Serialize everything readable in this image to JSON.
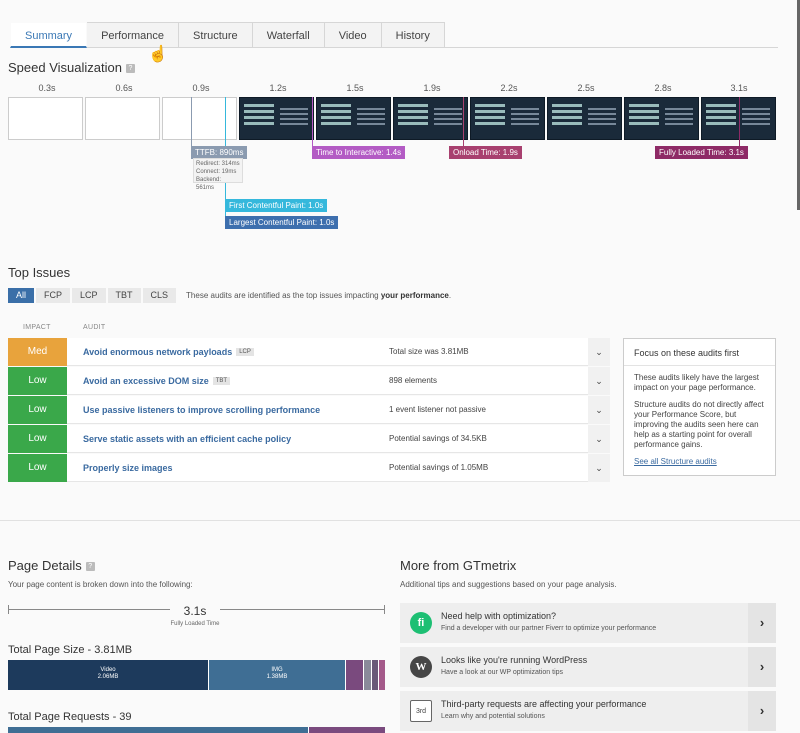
{
  "tabs": [
    {
      "label": "Summary"
    },
    {
      "label": "Performance"
    },
    {
      "label": "Structure"
    },
    {
      "label": "Waterfall"
    },
    {
      "label": "Video"
    },
    {
      "label": "History"
    }
  ],
  "speed_visualization": {
    "title": "Speed Visualization",
    "help": "?",
    "ticks": [
      "0.3s",
      "0.6s",
      "0.9s",
      "1.2s",
      "1.5s",
      "1.9s",
      "2.2s",
      "2.5s",
      "2.8s",
      "3.1s"
    ],
    "markers": {
      "ttfb": "TTFB: 890ms",
      "ttfb_detail": [
        "Redirect: 314ms",
        "Connect: 19ms",
        "Backend: 561ms"
      ],
      "tti": "Time to Interactive: 1.4s",
      "onload": "Onload Time: 1.9s",
      "fully_loaded": "Fully Loaded Time: 3.1s",
      "fcp": "First Contentful Paint: 1.0s",
      "lcp": "Largest Contentful Paint: 1.0s"
    },
    "colors": {
      "ttfb": "#8b9bb0",
      "tti": "#b35bc4",
      "onload": "#a8406f",
      "fully_loaded": "#8e2a66",
      "fcp": "#35b8dc",
      "lcp": "#3d6fae"
    }
  },
  "top_issues": {
    "title": "Top Issues",
    "filters": [
      "All",
      "FCP",
      "LCP",
      "TBT",
      "CLS"
    ],
    "note_prefix": "These audits are identified as the top issues impacting",
    "note_bold": "your performance",
    "note_suffix": ".",
    "col_impact": "IMPACT",
    "col_audit": "AUDIT",
    "rows": [
      {
        "impact": "Med",
        "audit": "Avoid enormous network payloads",
        "tag": "LCP",
        "value": "Total size was 3.81MB"
      },
      {
        "impact": "Low",
        "audit": "Avoid an excessive DOM size",
        "tag": "TBT",
        "value": "898 elements"
      },
      {
        "impact": "Low",
        "audit": "Use passive listeners to improve scrolling performance",
        "tag": "",
        "value": "1 event listener not passive"
      },
      {
        "impact": "Low",
        "audit": "Serve static assets with an efficient cache policy",
        "tag": "",
        "value": "Potential savings of 34.5KB"
      },
      {
        "impact": "Low",
        "audit": "Properly size images",
        "tag": "",
        "value": "Potential savings of 1.05MB"
      }
    ],
    "focus": {
      "title": "Focus on these audits first",
      "p1": "These audits likely have the largest impact on your page performance.",
      "p2": "Structure audits do not directly affect your Performance Score, but improving the audits seen here can help as a starting point for overall performance gains.",
      "link": "See all Structure audits"
    }
  },
  "page_details": {
    "title": "Page Details",
    "help": "?",
    "subtitle": "Your page content is broken down into the following:",
    "fully_loaded_value": "3.1s",
    "fully_loaded_label": "Fully Loaded Time",
    "total_size_title": "Total Page Size - 3.81MB",
    "size_segments": [
      {
        "label": "Video",
        "value": "2.06MB"
      },
      {
        "label": "IMG",
        "value": "1.38MB"
      },
      {
        "label": "",
        "value": ""
      },
      {
        "label": "",
        "value": ""
      },
      {
        "label": "",
        "value": ""
      },
      {
        "label": "",
        "value": ""
      }
    ],
    "total_requests_title": "Total Page Requests - 39"
  },
  "more": {
    "title": "More from GTmetrix",
    "subtitle": "Additional tips and suggestions based on your page analysis.",
    "items": [
      {
        "title": "Need help with optimization?",
        "sub": "Find a developer with our partner Fiverr to optimize your performance",
        "icon": "fi"
      },
      {
        "title": "Looks like you're running WordPress",
        "sub": "Have a look at our WP optimization tips",
        "icon": "W"
      },
      {
        "title": "Third-party requests are affecting your performance",
        "sub": "Learn why and potential solutions",
        "icon": "3rd"
      }
    ]
  }
}
